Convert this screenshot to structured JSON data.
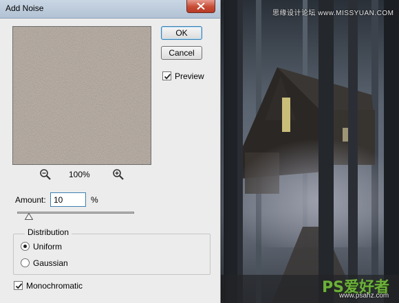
{
  "dialog": {
    "title": "Add Noise",
    "ok_label": "OK",
    "cancel_label": "Cancel",
    "preview_label": "Preview",
    "preview_checked": true,
    "zoom_level": "100%",
    "amount_label": "Amount:",
    "amount_value": "10",
    "amount_unit": "%",
    "amount_slider_fraction": 0.1,
    "distribution_title": "Distribution",
    "distribution_options": [
      "Uniform",
      "Gaussian"
    ],
    "distribution_selected": "Uniform",
    "monochromatic_label": "Monochromatic",
    "monochromatic_checked": true
  },
  "icons": {
    "close": "close-icon",
    "zoom_out": "zoom-out-icon",
    "zoom_in": "zoom-in-icon",
    "checkmark": "checkmark-icon"
  },
  "watermark": {
    "top_text": "思缘设计论坛 www.MISSYUAN.COM",
    "logo_text": "PS爱好者",
    "logo_sub": "www.psahz.com"
  },
  "colors": {
    "titlebar": "#b9c8d9",
    "close_button": "#c84b35",
    "dialog_bg": "#ececec",
    "noise_base": "#7c6f65",
    "logo_green": "#6db03a"
  }
}
